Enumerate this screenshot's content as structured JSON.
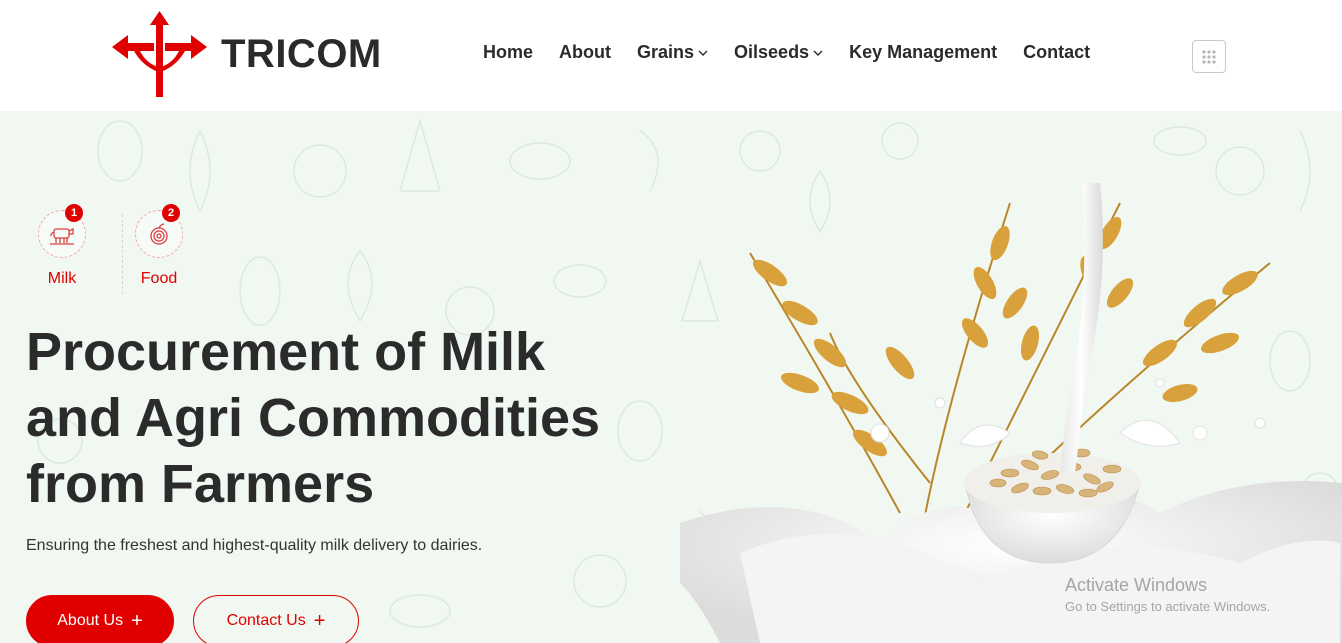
{
  "brand": {
    "name": "TRICOM",
    "accent": "#e00000"
  },
  "nav": {
    "items": [
      {
        "label": "Home"
      },
      {
        "label": "About"
      },
      {
        "label": "Grains"
      },
      {
        "label": "Oilseeds"
      },
      {
        "label": "Key Management"
      },
      {
        "label": "Contact"
      }
    ],
    "menu_icon": "grid-dots-icon"
  },
  "hero": {
    "categories": [
      {
        "num": "1",
        "label": "Milk",
        "icon": "cow-icon"
      },
      {
        "num": "2",
        "label": "Food",
        "icon": "onion-icon"
      }
    ],
    "headline_lines": [
      "Procurement of Milk",
      "and Agri Commodities",
      "from Farmers"
    ],
    "subtext": "Ensuring the freshest and highest-quality milk delivery to dairies.",
    "buttons": {
      "about": "About Us",
      "contact": "Contact Us"
    },
    "image": "milk-splash-oats-bowl-illustration"
  },
  "watermark": {
    "title": "Activate Windows",
    "subtitle": "Go to Settings to activate Windows."
  },
  "colors": {
    "hero_bg": "#f0f8f1",
    "text_dark": "#2b2b2b"
  }
}
